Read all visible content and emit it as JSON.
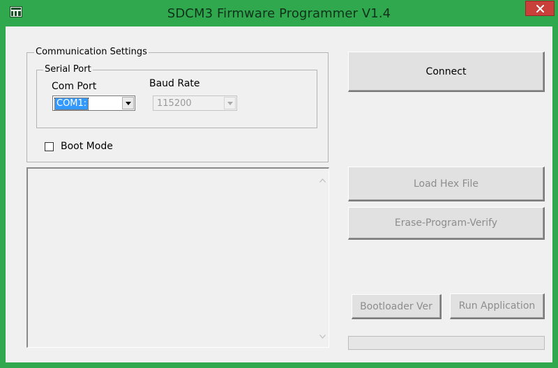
{
  "window": {
    "title": "SDCM3 Firmware Programmer V1.4",
    "title_bar_color": "#2fa84e",
    "close_button_color": "#c9403a",
    "app_icon": "app-icon",
    "close_icon": "close-icon"
  },
  "communication_settings": {
    "title": "Communication Settings",
    "serial_port": {
      "title": "Serial Port",
      "com_port_label": "Com Port",
      "com_port_value": "COM1:",
      "baud_rate_label": "Baud Rate",
      "baud_rate_value": "115200"
    },
    "boot_mode": {
      "label": "Boot Mode",
      "checked": false
    }
  },
  "buttons": {
    "connect": "Connect",
    "load_hex_file": "Load Hex File",
    "erase_program_verify": "Erase-Program-Verify",
    "bootloader_ver": "Bootloader Ver",
    "run_application": "Run Application"
  },
  "progress": {
    "value": 0
  }
}
